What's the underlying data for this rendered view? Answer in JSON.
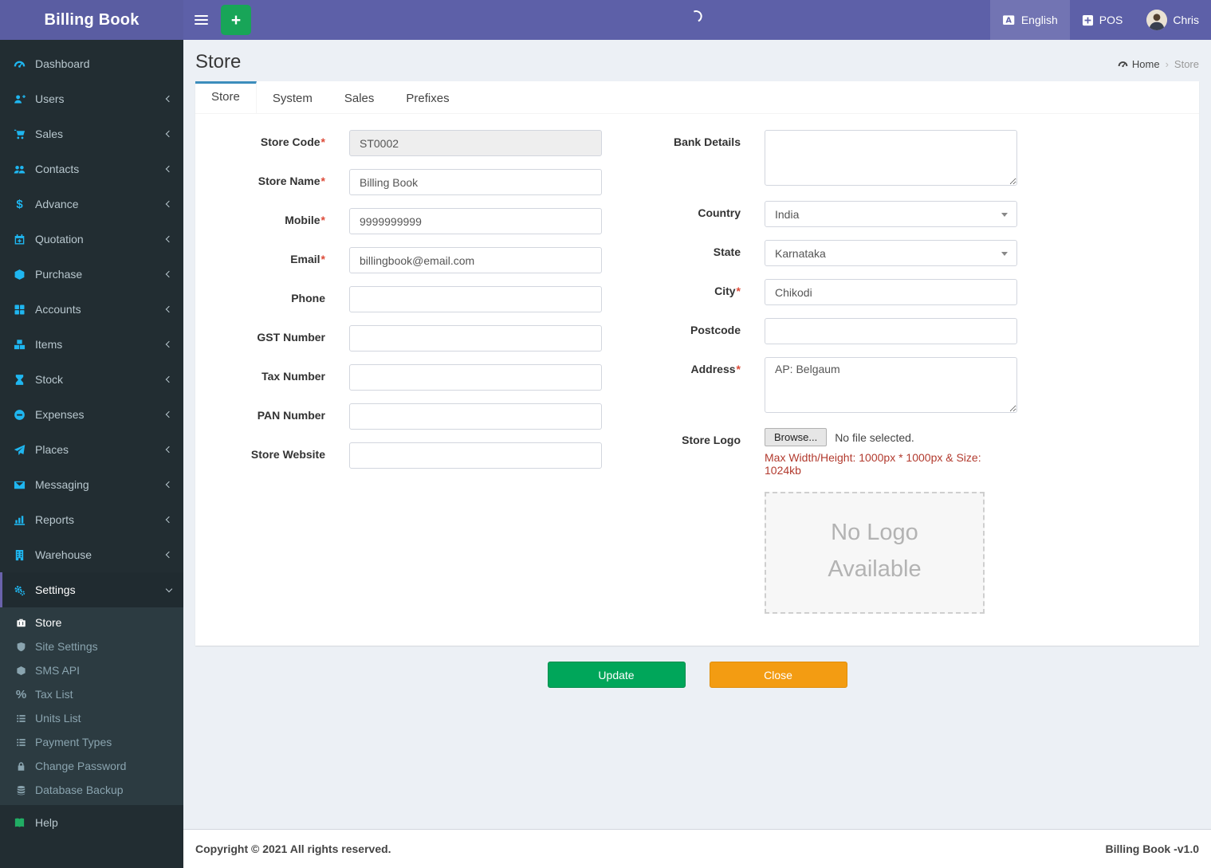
{
  "app": {
    "brand": "Billing Book"
  },
  "header": {
    "language": "English",
    "pos_label": "POS",
    "username": "Chris"
  },
  "icon_glyphs": {
    "dollar": "$",
    "percent": "%"
  },
  "sidebar": {
    "items": [
      {
        "icon": "gauge-icon",
        "label": "Dashboard"
      },
      {
        "icon": "user-plus-icon",
        "label": "Users"
      },
      {
        "icon": "cart-icon",
        "label": "Sales"
      },
      {
        "icon": "users-icon",
        "label": "Contacts"
      },
      {
        "icon": "dollar-icon",
        "label": "Advance"
      },
      {
        "icon": "calendar-plus-icon",
        "label": "Quotation"
      },
      {
        "icon": "cube-icon",
        "label": "Purchase"
      },
      {
        "icon": "grid-icon",
        "label": "Accounts"
      },
      {
        "icon": "cubes-icon",
        "label": "Items"
      },
      {
        "icon": "hourglass-icon",
        "label": "Stock"
      },
      {
        "icon": "minus-circle-icon",
        "label": "Expenses"
      },
      {
        "icon": "paper-plane-icon",
        "label": "Places"
      },
      {
        "icon": "envelope-icon",
        "label": "Messaging"
      },
      {
        "icon": "bar-chart-icon",
        "label": "Reports"
      },
      {
        "icon": "building-icon",
        "label": "Warehouse"
      },
      {
        "icon": "gears-icon",
        "label": "Settings",
        "active": true
      }
    ],
    "settings_children": [
      {
        "icon": "briefcase-icon",
        "label": "Store",
        "active": true
      },
      {
        "icon": "shield-icon",
        "label": "Site Settings"
      },
      {
        "icon": "cube-icon",
        "label": "SMS API"
      },
      {
        "icon": "percent-icon",
        "label": "Tax List"
      },
      {
        "icon": "list-icon",
        "label": "Units List"
      },
      {
        "icon": "list-icon",
        "label": "Payment Types"
      },
      {
        "icon": "lock-icon",
        "label": "Change Password"
      },
      {
        "icon": "database-icon",
        "label": "Database Backup"
      }
    ],
    "help": {
      "icon": "book-icon",
      "label": "Help"
    }
  },
  "page": {
    "title": "Store",
    "breadcrumb": {
      "home": "Home",
      "separator": "›",
      "current": "Store"
    }
  },
  "tabs": [
    {
      "label": "Store",
      "active": true
    },
    {
      "label": "System"
    },
    {
      "label": "Sales"
    },
    {
      "label": "Prefixes"
    }
  ],
  "form": {
    "required_mark": "*",
    "left": [
      {
        "label": "Store Code",
        "required": true,
        "value": "ST0002",
        "disabled": true
      },
      {
        "label": "Store Name",
        "required": true,
        "value": "Billing Book"
      },
      {
        "label": "Mobile",
        "required": true,
        "value": "9999999999"
      },
      {
        "label": "Email",
        "required": true,
        "value": "billingbook@email.com"
      },
      {
        "label": "Phone",
        "value": ""
      },
      {
        "label": "GST Number",
        "value": ""
      },
      {
        "label": "Tax Number",
        "value": ""
      },
      {
        "label": "PAN Number",
        "value": ""
      },
      {
        "label": "Store Website",
        "value": ""
      }
    ],
    "right": {
      "bank_details": {
        "label": "Bank Details",
        "value": ""
      },
      "country": {
        "label": "Country",
        "value": "India"
      },
      "state": {
        "label": "State",
        "value": "Karnataka"
      },
      "city": {
        "label": "City",
        "required": true,
        "value": "Chikodi"
      },
      "postcode": {
        "label": "Postcode",
        "value": ""
      },
      "address": {
        "label": "Address",
        "required": true,
        "value": "AP: Belgaum"
      },
      "store_logo": {
        "label": "Store Logo",
        "browse_label": "Browse...",
        "file_status": "No file selected.",
        "note": "Max Width/Height: 1000px * 1000px & Size: 1024kb",
        "placeholder": "No Logo Available"
      }
    }
  },
  "actions": {
    "update": "Update",
    "close": "Close"
  },
  "footer": {
    "copyright": "Copyright © 2021 All rights reserved.",
    "version": "Billing Book -v1.0"
  },
  "colors": {
    "header_purple": "#5d60a8",
    "sidebar_dark": "#222d32",
    "submenu_dark": "#2c3b41",
    "sidebar_icon_cyan": "#1fb6f0",
    "active_tab_border": "#3c8dbc",
    "update_green": "#00a65a",
    "close_orange": "#f39c12",
    "note_red": "#b23a2e",
    "required_red": "#dd4b39",
    "quick_add_green": "#18a558"
  }
}
